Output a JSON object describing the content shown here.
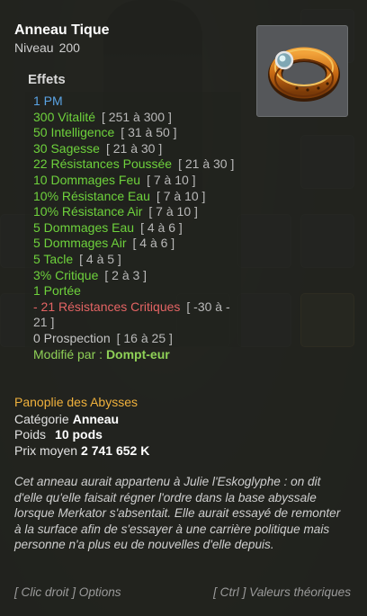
{
  "item": {
    "name": "Anneau Tique",
    "level_label": "Niveau",
    "level": "200",
    "image_icon": "ring-icon"
  },
  "effects": {
    "title": "Effets",
    "lines": [
      {
        "text": "1 PM",
        "range": "",
        "color": "blue"
      },
      {
        "text": "300 Vitalité",
        "range": "[ 251 à 300 ]",
        "color": "green"
      },
      {
        "text": "50 Intelligence",
        "range": "[ 31 à 50 ]",
        "color": "green"
      },
      {
        "text": "30 Sagesse",
        "range": "[ 21 à 30 ]",
        "color": "green"
      },
      {
        "text": "22 Résistances Poussée",
        "range": "[ 21 à 30 ]",
        "color": "green"
      },
      {
        "text": "10 Dommages Feu",
        "range": "[ 7 à 10 ]",
        "color": "green"
      },
      {
        "text": "10% Résistance Eau",
        "range": "[ 7 à 10 ]",
        "color": "green"
      },
      {
        "text": "10% Résistance Air",
        "range": "[ 7 à 10 ]",
        "color": "green"
      },
      {
        "text": "5 Dommages Eau",
        "range": "[ 4 à 6 ]",
        "color": "green"
      },
      {
        "text": "5 Dommages Air",
        "range": "[ 4 à 6 ]",
        "color": "green"
      },
      {
        "text": "5 Tacle",
        "range": "[ 4 à 5 ]",
        "color": "green"
      },
      {
        "text": "3% Critique",
        "range": "[ 2 à 3 ]",
        "color": "green"
      },
      {
        "text": "1 Portée",
        "range": "",
        "color": "green"
      },
      {
        "text": "- 21 Résistances Critiques",
        "range": "[ -30 à - 21 ]",
        "color": "red"
      },
      {
        "text": "0 Prospection",
        "range": "[ 16 à 25 ]",
        "color": "grey"
      }
    ],
    "modified_label": "Modifié par :",
    "modified_value": "Dompt-eur"
  },
  "info": {
    "set_name": "Panoplie des Abysses",
    "category_label": "Catégorie",
    "category_value": "Anneau",
    "weight_label": "Poids",
    "weight_value": "10 pods",
    "price_label": "Prix moyen",
    "price_value": "2 741 652 K"
  },
  "description": "Cet anneau aurait appartenu à Julie l'Eskoglyphe : on dit d'elle qu'elle faisait régner l'ordre dans la base abyssale lorsque Merkator s'absentait. Elle aurait essayé de remonter à la surface afin de s'essayer à une carrière politique mais personne n'a plus eu de nouvelles d'elle depuis.",
  "footer": {
    "left": "[ Clic droit ] Options",
    "right": "[ Ctrl ] Valeurs théoriques"
  },
  "colors": {
    "blue": "#5aa3e4",
    "green": "#6ed23c",
    "red": "#e46464",
    "grey": "#c4c4c4",
    "gold": "#f0b13c"
  }
}
